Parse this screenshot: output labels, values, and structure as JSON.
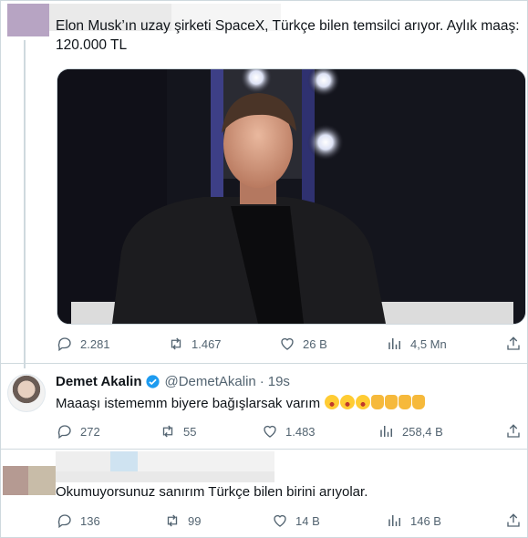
{
  "tweet1": {
    "text": "Elon Musk’ın uzay şirketi SpaceX, Türkçe bilen temsilci arıyor. Aylık maaş: 120.000 TL",
    "stats": {
      "replies": "2.281",
      "retweets": "1.467",
      "likes": "26 B",
      "views": "4,5 Mn"
    }
  },
  "tweet2": {
    "name": "Demet Akalin",
    "handle": "@DemetAkalin",
    "separator": "·",
    "time": "19s",
    "text": "Maaaşı istememm biyere bağışlarsak varım",
    "stats": {
      "replies": "272",
      "retweets": "55",
      "likes": "1.483",
      "views": "258,4 B"
    }
  },
  "tweet3": {
    "text": "Okumuyorsunuz sanırım Türkçe bilen birini arıyolar.",
    "stats": {
      "replies": "136",
      "retweets": "99",
      "likes": "14 B",
      "views": "146 B"
    }
  },
  "colors": {
    "text": "#0f1419",
    "muted": "#536471",
    "verified": "#1d9bf0",
    "border": "#cfd9de"
  }
}
